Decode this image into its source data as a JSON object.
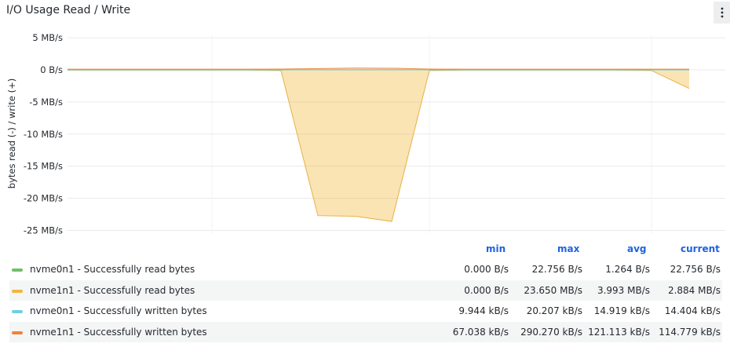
{
  "panel": {
    "title": "I/O Usage Read / Write",
    "menu_icon": "vertical-ellipsis-icon"
  },
  "chart_data": {
    "type": "area",
    "ylabel": "bytes read (-) / write (+)",
    "ylim": [
      -27,
      5.5
    ],
    "yticks": [
      "5 MB/s",
      "0 B/s",
      "-5 MB/s",
      "-10 MB/s",
      "-15 MB/s",
      "-20 MB/s",
      "-25 MB/s"
    ],
    "ytick_values": [
      5,
      0,
      -5,
      -10,
      -15,
      -20,
      -25
    ],
    "x": [
      0,
      1,
      2,
      3,
      4,
      5,
      6,
      7,
      8,
      9,
      10,
      11,
      12,
      13,
      14,
      15,
      16,
      17
    ],
    "series": [
      {
        "name": "nvme0n1 - Successfully read bytes",
        "color": "#73bf69",
        "values": [
          0.02,
          0.02,
          0.02,
          0.02,
          0.02,
          0.02,
          0.02,
          0.02,
          0.02,
          0.02,
          0.02,
          0.02,
          0.02,
          0.02,
          0.02,
          0.02,
          0.02,
          0.02
        ]
      },
      {
        "name": "nvme1n1 - Successfully read bytes",
        "color": "#f2c96d",
        "values": [
          -0.05,
          -0.05,
          -0.05,
          -0.05,
          -0.05,
          -0.05,
          -0.1,
          -22.7,
          -22.8,
          -23.6,
          -0.1,
          -0.05,
          -0.05,
          -0.05,
          -0.05,
          -0.05,
          -0.1,
          -2.9
        ]
      },
      {
        "name": "nvme0n1 - Successfully written bytes",
        "color": "#8ab8ff",
        "values": [
          0.015,
          0.015,
          0.015,
          0.015,
          0.015,
          0.015,
          0.015,
          0.015,
          0.015,
          0.015,
          0.015,
          0.015,
          0.015,
          0.015,
          0.015,
          0.015,
          0.015,
          0.015
        ]
      },
      {
        "name": "nvme1n1 - Successfully written bytes",
        "color": "#ff7f3f",
        "values": [
          0.1,
          0.1,
          0.1,
          0.1,
          0.1,
          0.1,
          0.12,
          0.2,
          0.28,
          0.25,
          0.12,
          0.1,
          0.1,
          0.1,
          0.1,
          0.1,
          0.1,
          0.11
        ]
      }
    ],
    "grid": true,
    "legend_placement": "bottom"
  },
  "legend": {
    "columns": [
      "min",
      "max",
      "avg",
      "current"
    ],
    "rows": [
      {
        "name": "nvme0n1 - Successfully read bytes",
        "color": "#73bf69",
        "min": "0.000 B/s",
        "max": "22.756 B/s",
        "avg": "1.264 B/s",
        "current": "22.756 B/s"
      },
      {
        "name": "nvme1n1 - Successfully read bytes",
        "color": "#f2b73a",
        "min": "0.000 B/s",
        "max": "23.650 MB/s",
        "avg": "3.993 MB/s",
        "current": "2.884 MB/s"
      },
      {
        "name": "nvme0n1 - Successfully written bytes",
        "color": "#6ed0e0",
        "min": "9.944 kB/s",
        "max": "20.207 kB/s",
        "avg": "14.919 kB/s",
        "current": "14.404 kB/s"
      },
      {
        "name": "nvme1n1 - Successfully written bytes",
        "color": "#ef843c",
        "min": "67.038 kB/s",
        "max": "290.270 kB/s",
        "avg": "121.113 kB/s",
        "current": "114.779 kB/s"
      }
    ]
  }
}
